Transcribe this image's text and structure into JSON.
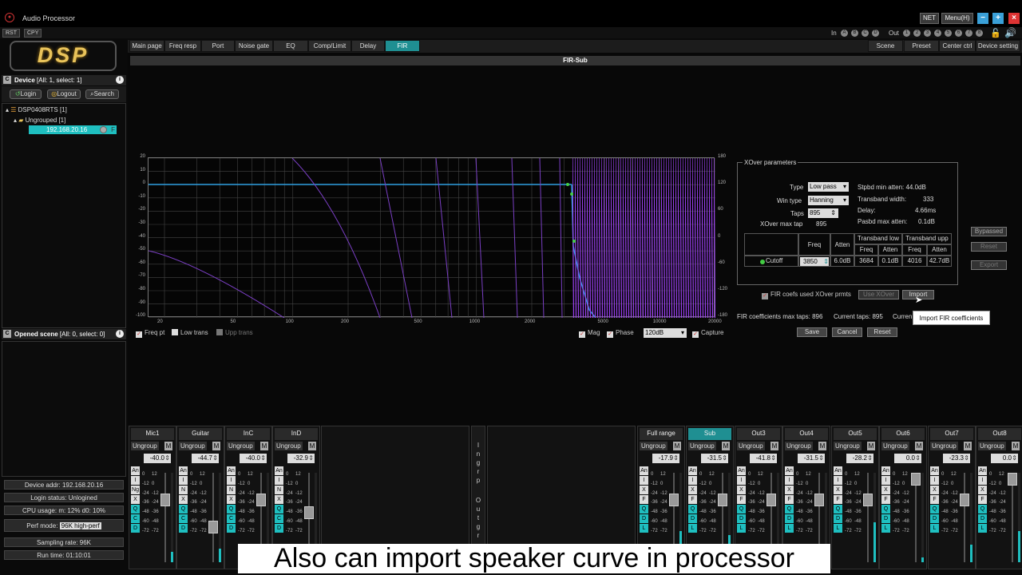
{
  "app": {
    "title": "Audio Processor",
    "net": "NET",
    "menu": "Menu(H)"
  },
  "toolbar": {
    "rst": "RST",
    "cpy": "CPY",
    "in_label": "In",
    "out_label": "Out",
    "in_dots": [
      "A",
      "B",
      "C",
      "D"
    ],
    "out_dots": [
      "1",
      "2",
      "3",
      "4",
      "5",
      "6",
      "7",
      "8"
    ]
  },
  "logo": "DSP",
  "device_panel": {
    "title": "Device",
    "subtitle": "[All: 1, select: 1]",
    "login": "Login",
    "logout": "Logout",
    "search": "Search",
    "device": "DSP0408RTS [1]",
    "group": "Ungrouped [1]",
    "ip": "192.168.20.16",
    "flag": "F"
  },
  "scene_panel": {
    "title": "Opened scene",
    "subtitle": "[All: 0, select: 0]"
  },
  "status": {
    "addr": "Device addr: 192.168.20.16",
    "login": "Login status: Unlogined",
    "cpu": "CPU usage: m: 12% d0: 10%",
    "perf_label": "Perf mode:",
    "perf_value": "96K high-perf",
    "rate": "Sampling rate: 96K",
    "runtime": "Run time: 01:10:01"
  },
  "tabs": [
    "Main page",
    "Freq resp",
    "Port",
    "Noise gate",
    "EQ",
    "Comp/Limit",
    "Delay",
    "FIR"
  ],
  "right_tabs": [
    "Scene",
    "Preset",
    "Center ctrl",
    "Device setting"
  ],
  "fir_title": "FIR-Sub",
  "chart": {
    "y_left": [
      "20",
      "10",
      "0",
      "-10",
      "-20",
      "-30",
      "-40",
      "-50",
      "-60",
      "-70",
      "-80",
      "-90",
      "-100"
    ],
    "y_right": [
      "180",
      "120",
      "60",
      "0",
      "-60",
      "-120",
      "-180"
    ],
    "x_ticks": [
      "20",
      "50",
      "100",
      "200",
      "500",
      "1000",
      "2000",
      "5000",
      "10000",
      "20000"
    ]
  },
  "plot_controls": {
    "freq_pt": "Freq pt",
    "low_trans": "Low trans",
    "upp_trans": "Upp trans",
    "mag": "Mag",
    "phase": "Phase",
    "range": "120dB",
    "capture": "Capture"
  },
  "xover": {
    "title": "XOver parameters",
    "type_label": "Type",
    "type": "Low pass",
    "win_label": "Win type",
    "win": "Hanning",
    "taps_label": "Taps",
    "taps": "895",
    "max_tap_label": "XOver max tap",
    "max_tap": "895",
    "stpbd": "Stpbd min atten: 44.0dB",
    "transband": "Transband width:",
    "transband_v": "333",
    "delay": "Delay:",
    "delay_v": "4.66ms",
    "pasbd": "Pasbd max atten:",
    "pasbd_v": "0.1dB",
    "col_freq": "Freq",
    "col_atten": "Atten",
    "col_tlow": "Transband low",
    "col_tupp": "Transband upp",
    "row_name": "Cutoff",
    "row_freq": "3850",
    "row_atten": "6.0dB",
    "low_freq": "3684",
    "low_atten": "0.1dB",
    "upp_freq": "4016",
    "upp_atten": "42.7dB"
  },
  "side_buttons": {
    "bypassed": "Bypassed",
    "reset": "Reset",
    "export": "Export"
  },
  "fir_opts": {
    "coefs_used": "FIR coefs used XOver prmts",
    "use_xover": "Use XOver",
    "import": "Import",
    "max_taps": "FIR coefficients max taps: 896",
    "cur_taps": "Current taps: 895",
    "cur_trunc": "Curren",
    "save": "Save",
    "cancel": "Cancel",
    "reset": "Reset"
  },
  "tooltip": "Import FIR coefficients",
  "inputs": [
    {
      "name": "Mic1",
      "value": "-40.0",
      "buttons": [
        "An",
        "I",
        "Ng",
        "X",
        "Q",
        "C",
        "D"
      ]
    },
    {
      "name": "Guitar",
      "value": "-44.7",
      "buttons": [
        "An",
        "I",
        "N",
        "X",
        "Q",
        "C",
        "D"
      ]
    },
    {
      "name": "InC",
      "value": "-40.0",
      "buttons": [
        "An",
        "I",
        "N",
        "X",
        "Q",
        "C",
        "D"
      ]
    },
    {
      "name": "InD",
      "value": "-32.9",
      "buttons": [
        "An",
        "I",
        "N",
        "X",
        "Q",
        "C",
        "D"
      ]
    }
  ],
  "outputs": [
    {
      "name": "Full range",
      "value": "-17.9",
      "buttons": [
        "An",
        "I",
        "X",
        "F",
        "Q",
        "D",
        "L"
      ]
    },
    {
      "name": "Sub",
      "value": "-31.5",
      "buttons": [
        "An",
        "I",
        "X",
        "F",
        "Q",
        "D",
        "L"
      ]
    },
    {
      "name": "Out3",
      "value": "-41.8",
      "buttons": [
        "An",
        "I",
        "X",
        "F",
        "Q",
        "D",
        "L"
      ]
    },
    {
      "name": "Out4",
      "value": "-31.5",
      "buttons": [
        "An",
        "I",
        "X",
        "F",
        "Q",
        "D",
        "L"
      ]
    },
    {
      "name": "Out5",
      "value": "-28.2",
      "buttons": [
        "An",
        "I",
        "X",
        "F",
        "Q",
        "D",
        "L"
      ]
    },
    {
      "name": "Out6",
      "value": "0.0",
      "buttons": [
        "An",
        "I",
        "X",
        "F",
        "Q",
        "D",
        "L"
      ]
    },
    {
      "name": "Out7",
      "value": "-23.3",
      "buttons": [
        "An",
        "I",
        "X",
        "F",
        "Q",
        "D",
        "L"
      ]
    },
    {
      "name": "Out8",
      "value": "0.0",
      "buttons": [
        "An",
        "I",
        "X",
        "F",
        "Q",
        "D",
        "L"
      ]
    }
  ],
  "channel": {
    "ungroup": "Ungroup",
    "mute": "M",
    "scale_a": [
      "0",
      "-12",
      "-24",
      "-36",
      "-48",
      "-60",
      "-72"
    ],
    "scale_b": [
      "12",
      "0",
      "-12",
      "-24",
      "-36",
      "-48",
      "-72"
    ]
  },
  "ingr": "I n g r p",
  "outgr": "O u t g r",
  "caption": "Also can import speaker curve in processor"
}
